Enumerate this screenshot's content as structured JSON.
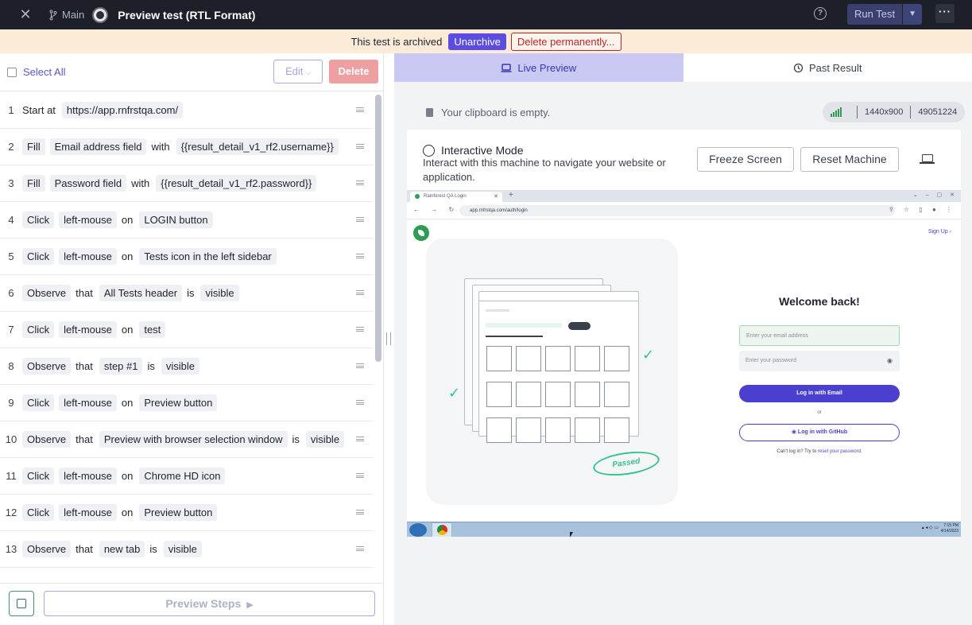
{
  "topbar": {
    "close_icon": "close-icon",
    "branch_label": "Main",
    "title": "Preview test (RTL Format)",
    "help_icon": "help-icon",
    "run_label": "Run Test",
    "more_icon": "more-icon"
  },
  "banner": {
    "message": "This test is archived",
    "unarchive_label": "Unarchive",
    "delete_label": "Delete permanently..."
  },
  "left_toolbar": {
    "select_all": "Select All",
    "edit_label": "Edit",
    "delete_label": "Delete"
  },
  "steps": [
    {
      "num": "1",
      "tokens": [
        {
          "t": "Start at",
          "k": "plain"
        },
        {
          "t": "https://app.rnfrstqa.com/",
          "k": "chip"
        }
      ]
    },
    {
      "num": "2",
      "tokens": [
        {
          "t": "Fill",
          "k": "chip"
        },
        {
          "t": "Email address field",
          "k": "chip"
        },
        {
          "t": "with",
          "k": "plain"
        },
        {
          "t": "{{result_detail_v1_rf2.username}}",
          "k": "chip"
        }
      ]
    },
    {
      "num": "3",
      "tokens": [
        {
          "t": "Fill",
          "k": "chip"
        },
        {
          "t": "Password field",
          "k": "chip"
        },
        {
          "t": "with",
          "k": "plain"
        },
        {
          "t": "{{result_detail_v1_rf2.password}}",
          "k": "chip"
        }
      ]
    },
    {
      "num": "4",
      "tokens": [
        {
          "t": "Click",
          "k": "chip"
        },
        {
          "t": "left-mouse",
          "k": "chip"
        },
        {
          "t": "on",
          "k": "plain"
        },
        {
          "t": "LOGIN button",
          "k": "chip"
        }
      ]
    },
    {
      "num": "5",
      "tokens": [
        {
          "t": "Click",
          "k": "chip"
        },
        {
          "t": "left-mouse",
          "k": "chip"
        },
        {
          "t": "on",
          "k": "plain"
        },
        {
          "t": "Tests icon in the left sidebar",
          "k": "chip"
        }
      ]
    },
    {
      "num": "6",
      "tokens": [
        {
          "t": "Observe",
          "k": "chip"
        },
        {
          "t": "that",
          "k": "plain"
        },
        {
          "t": "All Tests header",
          "k": "chip"
        },
        {
          "t": "is",
          "k": "plain"
        },
        {
          "t": "visible",
          "k": "chip"
        }
      ]
    },
    {
      "num": "7",
      "tokens": [
        {
          "t": "Click",
          "k": "chip"
        },
        {
          "t": "left-mouse",
          "k": "chip"
        },
        {
          "t": "on",
          "k": "plain"
        },
        {
          "t": "test",
          "k": "chip"
        }
      ]
    },
    {
      "num": "8",
      "tokens": [
        {
          "t": "Observe",
          "k": "chip"
        },
        {
          "t": "that",
          "k": "plain"
        },
        {
          "t": "step #1",
          "k": "chip"
        },
        {
          "t": "is",
          "k": "plain"
        },
        {
          "t": "visible",
          "k": "chip"
        }
      ]
    },
    {
      "num": "9",
      "tokens": [
        {
          "t": "Click",
          "k": "chip"
        },
        {
          "t": "left-mouse",
          "k": "chip"
        },
        {
          "t": "on",
          "k": "plain"
        },
        {
          "t": "Preview button",
          "k": "chip"
        }
      ]
    },
    {
      "num": "10",
      "tokens": [
        {
          "t": "Observe",
          "k": "chip"
        },
        {
          "t": "that",
          "k": "plain"
        },
        {
          "t": "Preview with browser selection window",
          "k": "chip"
        },
        {
          "t": "is",
          "k": "plain"
        },
        {
          "t": "visible",
          "k": "chip"
        }
      ]
    },
    {
      "num": "11",
      "tokens": [
        {
          "t": "Click",
          "k": "chip"
        },
        {
          "t": "left-mouse",
          "k": "chip"
        },
        {
          "t": "on",
          "k": "plain"
        },
        {
          "t": "Chrome HD icon",
          "k": "chip"
        }
      ]
    },
    {
      "num": "12",
      "tokens": [
        {
          "t": "Click",
          "k": "chip"
        },
        {
          "t": "left-mouse",
          "k": "chip"
        },
        {
          "t": "on",
          "k": "plain"
        },
        {
          "t": "Preview button",
          "k": "chip"
        }
      ]
    },
    {
      "num": "13",
      "tokens": [
        {
          "t": "Observe",
          "k": "chip"
        },
        {
          "t": "that",
          "k": "plain"
        },
        {
          "t": "new tab",
          "k": "chip"
        },
        {
          "t": "is",
          "k": "plain"
        },
        {
          "t": "visible",
          "k": "chip"
        }
      ]
    }
  ],
  "left_bottom": {
    "preview_label": "Preview Steps"
  },
  "tabs": {
    "live": "Live Preview",
    "past": "Past Result"
  },
  "clipboard": "Your clipboard is empty.",
  "machine": {
    "resolution": "1440x900",
    "id": "49051224"
  },
  "interactive": {
    "title": "Interactive Mode",
    "description": "Interact with this machine to navigate your website or application.",
    "freeze_label": "Freeze Screen",
    "reset_label": "Reset Machine"
  },
  "screen": {
    "tab_title": "Rainforest QA Login",
    "url": "app.rnfrstqa.com/auth/login",
    "signup": "Sign Up ›",
    "passed": "Passed",
    "welcome": "Welcome back!",
    "email_placeholder": "Enter your email address",
    "password_placeholder": "Enter your password",
    "login_email": "Log in with Email",
    "or": "or",
    "login_github": "Log in with GitHub",
    "cant_prefix": "Can't log in? Try to",
    "cant_link": "reset your password.",
    "clock_time": "7:15 PM",
    "clock_date": "4/14/2023"
  }
}
